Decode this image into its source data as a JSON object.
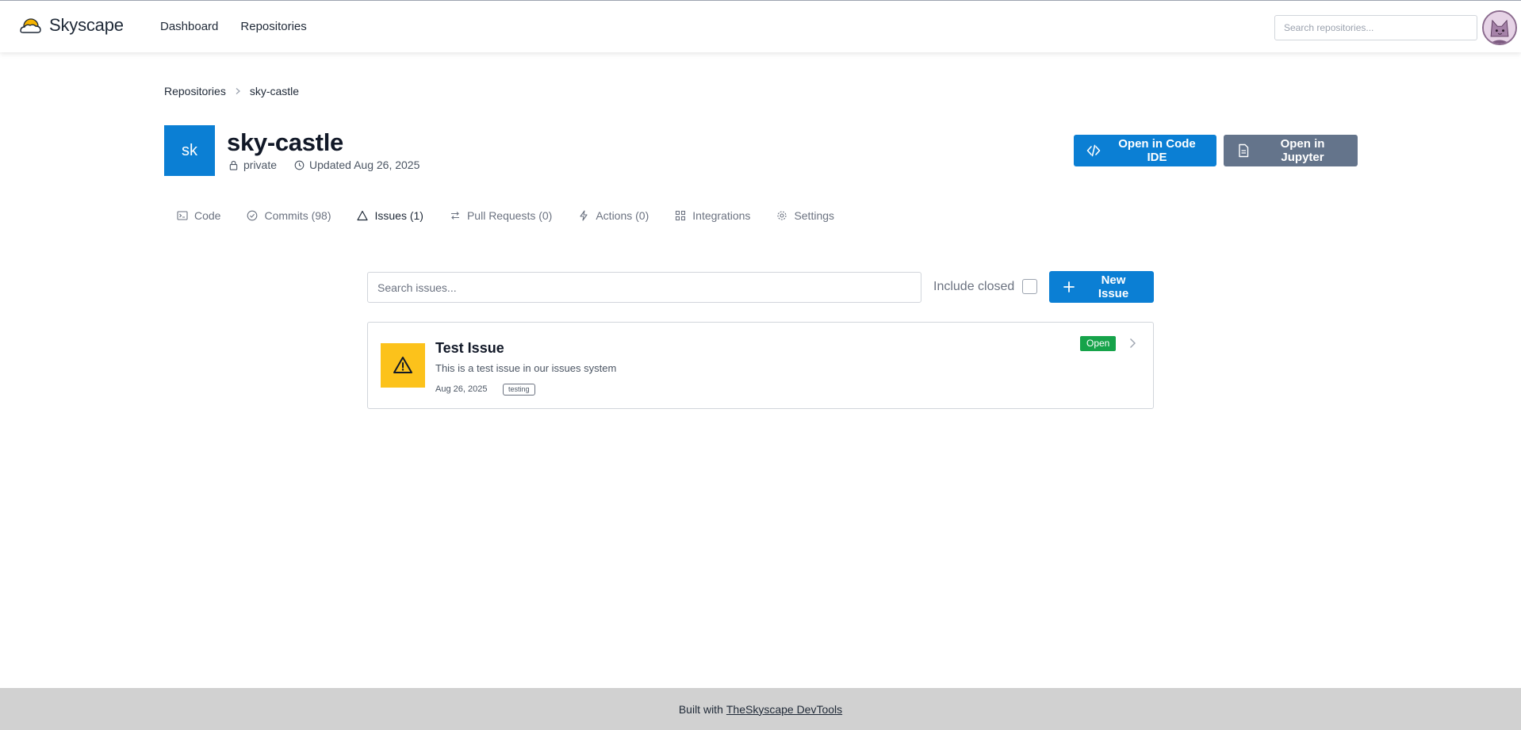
{
  "navbar": {
    "brand": "Skyscape",
    "links": [
      "Dashboard",
      "Repositories"
    ],
    "search_placeholder": "Search repositories..."
  },
  "breadcrumb": {
    "parent": "Repositories",
    "current": "sky-castle"
  },
  "repo": {
    "badge": "sk",
    "name": "sky-castle",
    "visibility": "private",
    "updated": "Updated Aug 26, 2025",
    "open_ide_label": "Open in Code IDE",
    "open_jupyter_label": "Open in Jupyter"
  },
  "tabs": [
    {
      "label": "Code",
      "icon": "terminal-icon"
    },
    {
      "label": "Commits (98)",
      "icon": "check-circle-icon"
    },
    {
      "label": "Issues (1)",
      "icon": "alert-triangle-icon"
    },
    {
      "label": "Pull Requests (0)",
      "icon": "arrows-icon"
    },
    {
      "label": "Actions (0)",
      "icon": "lightning-icon"
    },
    {
      "label": "Integrations",
      "icon": "grid-icon"
    },
    {
      "label": "Settings",
      "icon": "gear-icon"
    }
  ],
  "active_tab": "Issues (1)",
  "issues": {
    "search_placeholder": "Search issues...",
    "include_closed_label": "Include closed",
    "include_closed_checked": false,
    "new_issue_label": "New Issue",
    "items": [
      {
        "title": "Test Issue",
        "description": "This is a test issue in our issues system",
        "date": "Aug 26, 2025",
        "label": "testing",
        "status": "Open"
      }
    ]
  },
  "footer": {
    "prefix": "Built with",
    "link": "TheSkyscape DevTools"
  },
  "colors": {
    "primary": "#0b7fd4",
    "secondary": "#64748b",
    "warning": "#fcc21b",
    "success": "#16a34a",
    "footer_bg": "#d1d1d1"
  }
}
